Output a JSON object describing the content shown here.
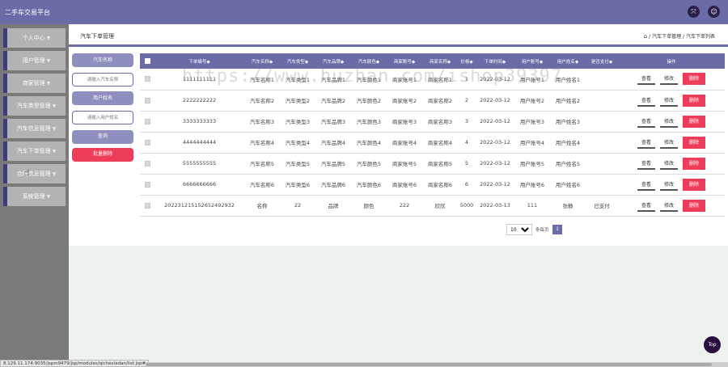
{
  "app": {
    "title": "二手车交易平台"
  },
  "header_icons": [
    "expand-icon",
    "user-icon"
  ],
  "sidebar": {
    "items": [
      {
        "label": "个人中心"
      },
      {
        "label": "用户管理"
      },
      {
        "label": "商家管理"
      },
      {
        "label": "汽车类型管理"
      },
      {
        "label": "汽车信息管理"
      },
      {
        "label": "汽车下单管理"
      },
      {
        "label": "合同信息管理"
      },
      {
        "label": "系统管理"
      }
    ]
  },
  "page": {
    "title": "汽车下单管理",
    "breadcrumb": {
      "sep1": "/",
      "b1": "汽车下单管理",
      "sep2": "/",
      "b2": "汽车下单列表"
    }
  },
  "filters": {
    "car_name_label": "汽车名称",
    "car_name_placeholder": "请输入汽车名称",
    "user_name_label": "用户姓名",
    "user_name_placeholder": "请输入用户姓名",
    "search_button": "查询",
    "batch_delete_button": "批量删除"
  },
  "table": {
    "columns": [
      "下单编号◆",
      "汽车名称◆",
      "汽车类型◆",
      "汽车品牌◆",
      "汽车颜色◆",
      "商家账号◆",
      "商家名称◆",
      "价格◆",
      "下单时间◆",
      "用户账号◆",
      "用户姓名◆",
      "是否支付◆",
      "操作"
    ],
    "actions": {
      "view": "查看",
      "edit": "修改",
      "delete": "删除"
    },
    "rows": [
      [
        "1111111111",
        "汽车名称1",
        "汽车类型1",
        "汽车品牌1",
        "汽车颜色1",
        "商家账号1",
        "商家名称1",
        "1",
        "2022-03-12",
        "用户账号1",
        "用户姓名1",
        ""
      ],
      [
        "2222222222",
        "汽车名称2",
        "汽车类型2",
        "汽车品牌2",
        "汽车颜色2",
        "商家账号2",
        "商家名称2",
        "2",
        "2022-03-12",
        "用户账号2",
        "用户姓名2",
        ""
      ],
      [
        "3333333333",
        "汽车名称3",
        "汽车类型3",
        "汽车品牌3",
        "汽车颜色3",
        "商家账号3",
        "商家名称3",
        "3",
        "2022-03-12",
        "用户账号3",
        "用户姓名3",
        ""
      ],
      [
        "4444444444",
        "汽车名称4",
        "汽车类型4",
        "汽车品牌4",
        "汽车颜色4",
        "商家账号4",
        "商家名称4",
        "4",
        "2022-03-12",
        "用户账号4",
        "用户姓名4",
        ""
      ],
      [
        "5555555555",
        "汽车名称5",
        "汽车类型5",
        "汽车品牌5",
        "汽车颜色5",
        "商家账号5",
        "商家名称5",
        "5",
        "2022-03-12",
        "用户账号5",
        "用户姓名5",
        ""
      ],
      [
        "6666666666",
        "汽车名称6",
        "汽车类型6",
        "汽车品牌6",
        "汽车颜色6",
        "商家账号6",
        "商家名称6",
        "6",
        "2022-03-12",
        "用户账号6",
        "用户姓名6",
        ""
      ],
      [
        "20223121515265249293​2",
        "名称",
        "22",
        "品牌",
        "颜色",
        "222",
        "欣欣",
        "5000",
        "2022-03-13",
        "111",
        "张静",
        "已支付"
      ]
    ]
  },
  "pagination": {
    "page_size": "10",
    "per_page_label": "条每页",
    "current_page": "1"
  },
  "top_button": "Top",
  "status_url": "8.129.11.174:9035/jspm9479/jsp/modules/qichexiadan/list.jsp#",
  "watermark": "https://www.huzhan.com/ishop39397",
  "colors": {
    "primary": "#6b6ba8",
    "danger": "#ee3d5a",
    "sidebar": "#7a7a7a"
  }
}
